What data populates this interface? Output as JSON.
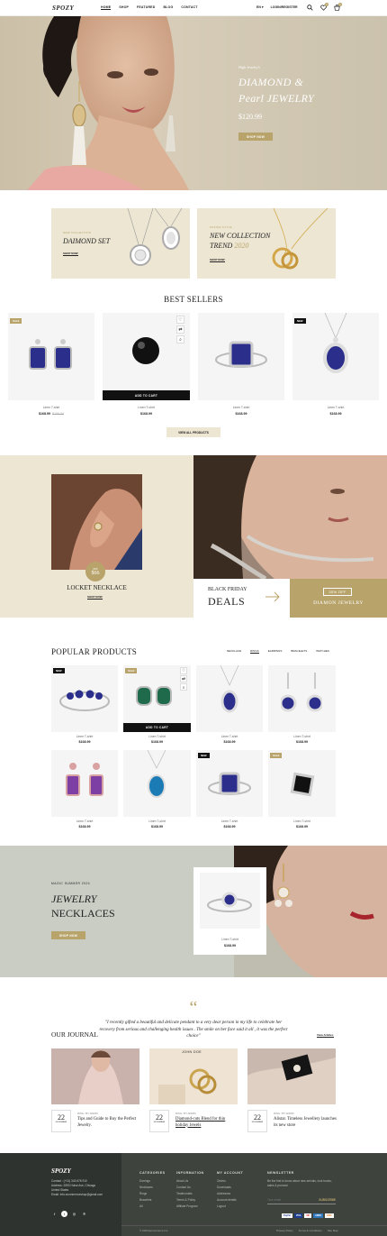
{
  "header": {
    "logo": "SPOZY",
    "nav": [
      "HOME",
      "SHOP",
      "FEATURED",
      "BLOG",
      "CONTACT"
    ],
    "lang": "EN",
    "login": "LOGIN/REGISTER",
    "wishlist_count": "0",
    "cart_count": "0"
  },
  "hero": {
    "kicker": "High Jewelry's",
    "title_line1": "DIAMOND &",
    "title_line2": "Pearl JEWELRY",
    "price": "$120.99",
    "button": "SHOP NOW"
  },
  "banners": [
    {
      "kicker": "NEW COLLECTION",
      "title": "DAIMOND SET",
      "link": "SHOP NOW"
    },
    {
      "kicker": "OFFICE STYLE",
      "title_line1": "NEW COLLECTION",
      "title_line2_a": "TREND",
      "title_line2_b": "2020",
      "link": "SHOP NOW"
    }
  ],
  "best_sellers": {
    "title": "BEST SELLERS",
    "add_to_cart": "ADD TO CART",
    "view_all": "VIEW ALL PRODUCTS",
    "products": [
      {
        "name": "Linen T-shirt",
        "price": "$168.99",
        "old_price": "$189.00",
        "tag": "SALE"
      },
      {
        "name": "Linen T-shirt",
        "price": "$168.99"
      },
      {
        "name": "Linen T-shirt",
        "price": "$168.99"
      },
      {
        "name": "Linen T-shirt",
        "price": "$168.99",
        "tag": "NEW"
      }
    ]
  },
  "promo": {
    "offer_label": "OFF",
    "offer_value": "$66",
    "card_title": "LOCKET NECKLACE",
    "card_link": "SHOP NOW",
    "deal_line1": "BLACK FRIDAY",
    "deal_line2": "DEALS",
    "off_badge": "30% OFF",
    "off_label": "DIAMON JEWELRY"
  },
  "popular": {
    "title": "POPULAR PRODUCTS",
    "tabs": [
      "NECKLACE",
      "RINGS",
      "EARRINGS",
      "BRACELETS",
      "WATCHES"
    ],
    "add_to_cart": "ADD TO CART",
    "products": [
      {
        "name": "Linen T-shirt",
        "price": "$168.99",
        "tag": "NEW"
      },
      {
        "name": "Linen T-shirt",
        "price": "$168.99",
        "tag": "SALE"
      },
      {
        "name": "Linen T-shirt",
        "price": "$168.99"
      },
      {
        "name": "Linen T-shirt",
        "price": "$168.99"
      },
      {
        "name": "Linen T-shirt",
        "price": "$168.99"
      },
      {
        "name": "Linen T-shirt",
        "price": "$168.99"
      },
      {
        "name": "Linen T-shirt",
        "price": "$168.99",
        "tag": "NEW"
      },
      {
        "name": "Linen T-shirt",
        "price": "$168.99",
        "tag": "SALE"
      }
    ]
  },
  "summer": {
    "kicker": "MAGIC SUMMER 2024",
    "title_line1": "JEWELRY",
    "title_line2": "NECKLACES",
    "button": "SHOP NOW",
    "product_name": "Linen T-shirt",
    "product_price": "$168.99"
  },
  "journal": {
    "quote": "\"I recently gifted a beautiful and delicate pendant to a very dear person in my life to celebrate her recovery from serious and challenging health issues . The smile on her face said it all , it was the perfect choice\"",
    "author": "JOHN DOE",
    "title": "OUR JOURNAL",
    "view_all": "View Articles",
    "posts": [
      {
        "day": "22",
        "month": "NOVEMBER",
        "meta": "RING  /  BY ADMIN",
        "title": "Tips and Guide to Buy the Perfect Jewelry."
      },
      {
        "day": "22",
        "month": "NOVEMBER",
        "meta": "RING  /  BY ADMIN",
        "title": "Diamond-cuts Blend for thin holiday Jewels"
      },
      {
        "day": "22",
        "month": "NOVEMBER",
        "meta": "RING  /  BY ADMIN",
        "title": "Alistar. Timeless Jewellery launches its new store"
      }
    ]
  },
  "footer": {
    "logo": "SPOZY",
    "contact": "Contact : (+01) 343 678 910",
    "address_line1": "Address: 2593 Hulse Ave, Chicago",
    "address_line2": "United States",
    "email": "Email: info.ecommerceshop@gmail.com",
    "columns": [
      {
        "heading": "CATEGORIES",
        "items": [
          "Earrings",
          "Necklaces",
          "Rings",
          "Bracelets",
          "All"
        ]
      },
      {
        "heading": "INFORMATION",
        "items": [
          "About Us",
          "Contact Us",
          "Testimonials",
          "Terms & Policy",
          "Affiliate Program"
        ]
      },
      {
        "heading": "MY ACCOUNT",
        "items": [
          "Orders",
          "Downloads",
          "Addresses",
          "Account details",
          "Logout"
        ]
      }
    ],
    "newsletter_heading": "NEWSLETTER",
    "newsletter_text": "Be the first to know about new arrivals, look books, sales & promos!",
    "email_placeholder": "Your email",
    "subscribe": "SUBSCRIBE",
    "copyright": "© 2024 Ecommerce Inc.",
    "payments": [
      "PayPal",
      "VISA",
      "MC",
      "AMEX",
      "DISC"
    ],
    "legal": [
      "Privacy Policy",
      "Terms & Conditions",
      "Site Map"
    ]
  },
  "colors": {
    "gold": "#b8a36a",
    "dark": "#111111",
    "footer": "#3e433e",
    "cream": "#ede6d3"
  }
}
